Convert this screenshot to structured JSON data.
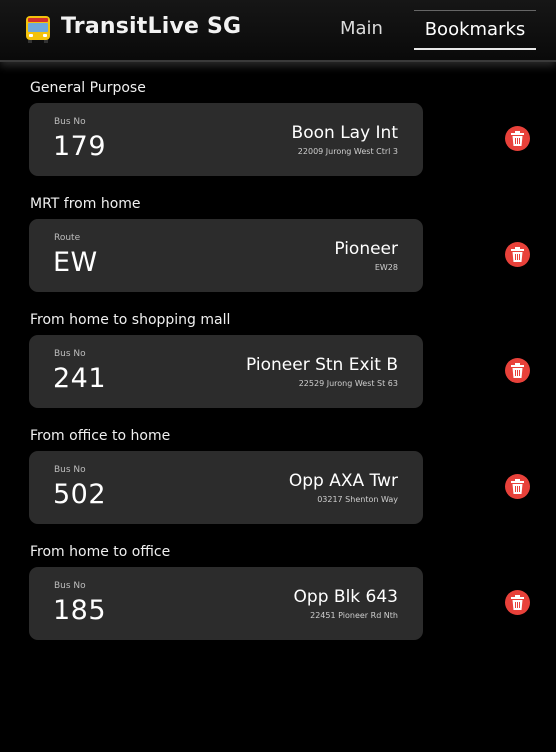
{
  "header": {
    "logo_icon": "bus-icon",
    "app_title": "TransitLive SG",
    "tabs": [
      {
        "label": "Main",
        "active": false
      },
      {
        "label": "Bookmarks",
        "active": true
      }
    ]
  },
  "bookmarks": [
    {
      "group": "General Purpose",
      "kind": "Bus No",
      "number": "179",
      "stop_name": "Boon Lay Int",
      "stop_detail": "22009 Jurong West Ctrl 3"
    },
    {
      "group": "MRT from home",
      "kind": "Route",
      "number": "EW",
      "stop_name": "Pioneer",
      "stop_detail": "EW28"
    },
    {
      "group": "From home to shopping mall",
      "kind": "Bus No",
      "number": "241",
      "stop_name": "Pioneer Stn Exit B",
      "stop_detail": "22529 Jurong West St 63"
    },
    {
      "group": "From office to home",
      "kind": "Bus No",
      "number": "502",
      "stop_name": "Opp AXA Twr",
      "stop_detail": "03217 Shenton Way"
    },
    {
      "group": "From home to office",
      "kind": "Bus No",
      "number": "185",
      "stop_name": "Opp Blk 643",
      "stop_detail": "22451 Pioneer Rd Nth"
    }
  ],
  "colors": {
    "delete_button": "#e8413a",
    "card_background": "#2c2c2c",
    "page_background": "#000000"
  },
  "delete_icon": "trash-icon"
}
